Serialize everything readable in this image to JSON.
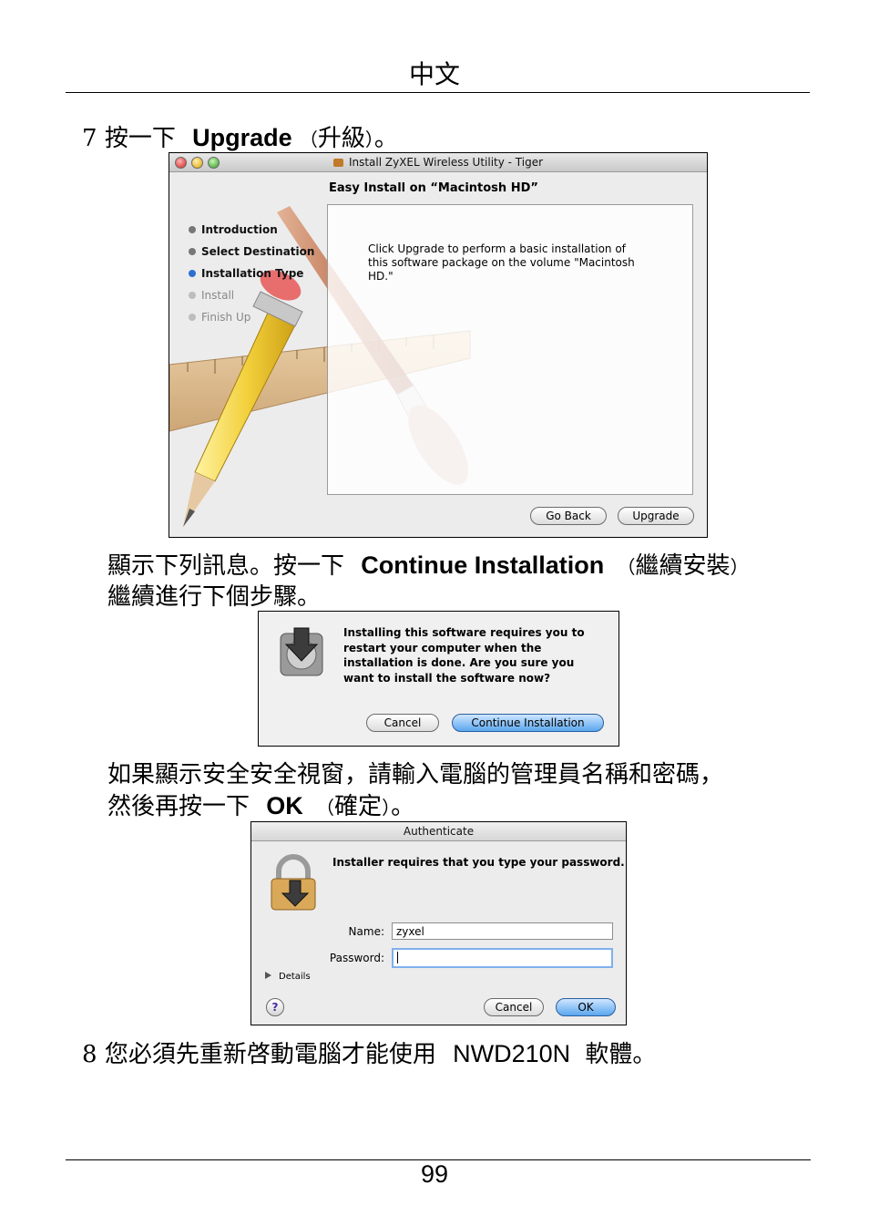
{
  "header": {
    "language": "中文"
  },
  "step7": {
    "number": "7",
    "prefix": "按一下",
    "action": "Upgrade",
    "paren_open": "（",
    "action_zh": "升級",
    "paren_close": "）",
    "period": "。"
  },
  "installer_window": {
    "title": "Install ZyXEL Wireless Utility - Tiger",
    "heading": "Easy Install on “Macintosh HD”",
    "steps": [
      {
        "label": "Introduction",
        "state": "done"
      },
      {
        "label": "Select Destination",
        "state": "done"
      },
      {
        "label": "Installation Type",
        "state": "current"
      },
      {
        "label": "Install",
        "state": "pending"
      },
      {
        "label": "Finish Up",
        "state": "pending"
      }
    ],
    "body": "Click Upgrade to perform a basic installation of this software package on the volume \"Macintosh HD.\"",
    "go_back": "Go Back",
    "upgrade": "Upgrade"
  },
  "para2": {
    "prefix": "顯示下列訊息。按一下",
    "action": "Continue Installation",
    "paren_open": "（",
    "action_zh": "繼續安裝",
    "paren_close": "）",
    "line2": "繼續進行下個步驟。"
  },
  "restart_dialog": {
    "message": "Installing this software requires you to restart your computer when the installation is done. Are you sure you want to install the software now?",
    "cancel": "Cancel",
    "continue": "Continue Installation"
  },
  "para3": {
    "line1": "如果顯示安全安全視窗，請輸入電腦的管理員名稱和密碼，",
    "prefix": "然後再按一下",
    "action": "OK",
    "paren_open": "（",
    "action_zh": "確定",
    "paren_close": "）",
    "period": "。"
  },
  "auth_dialog": {
    "title": "Authenticate",
    "message": "Installer requires that you type your password.",
    "name_label": "Name:",
    "name_value": "zyxel",
    "password_label": "Password:",
    "details": "Details",
    "cancel": "Cancel",
    "ok": "OK"
  },
  "step8": {
    "number": "8",
    "text": "您必須先重新啓動電腦才能使用",
    "product": "NWD210N",
    "suffix": "軟體。"
  },
  "footer": {
    "page_number": "99"
  }
}
